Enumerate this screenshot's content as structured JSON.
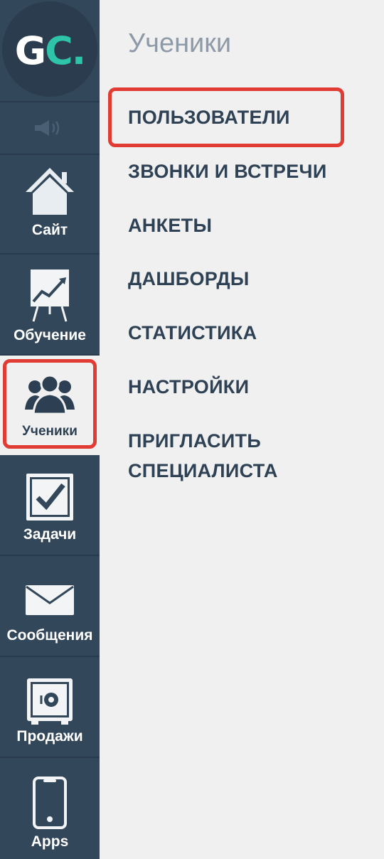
{
  "logo": {
    "letter_g": "G",
    "letter_c": "C",
    "dot": "."
  },
  "sound_icon": "speaker-icon",
  "nav": [
    {
      "label": "Сайт",
      "icon": "home-icon"
    },
    {
      "label": "Обучение",
      "icon": "presentation-chart-icon"
    },
    {
      "label": "Ученики",
      "icon": "users-icon",
      "active": true
    },
    {
      "label": "Задачи",
      "icon": "checkbox-icon"
    },
    {
      "label": "Сообщения",
      "icon": "envelope-icon"
    },
    {
      "label": "Продажи",
      "icon": "safe-icon"
    },
    {
      "label": "Apps",
      "icon": "smartphone-icon"
    }
  ],
  "submenu": {
    "title": "Ученики",
    "items": [
      "ПОЛЬЗОВАТЕЛИ",
      "ЗВОНКИ И ВСТРЕЧИ",
      "АНКЕТЫ",
      "ДАШБОРДЫ",
      "СТАТИСТИКА",
      "НАСТРОЙКИ",
      "ПРИГЛАСИТЬ",
      "СПЕЦИАЛИСТА"
    ]
  },
  "colors": {
    "sidebar_bg": "#33475b",
    "accent_teal": "#2ec4a9",
    "highlight_red": "#e03c34",
    "menu_text": "#2f4255",
    "title_text": "#8e9aa8",
    "content_bg": "#f0f0f0"
  }
}
